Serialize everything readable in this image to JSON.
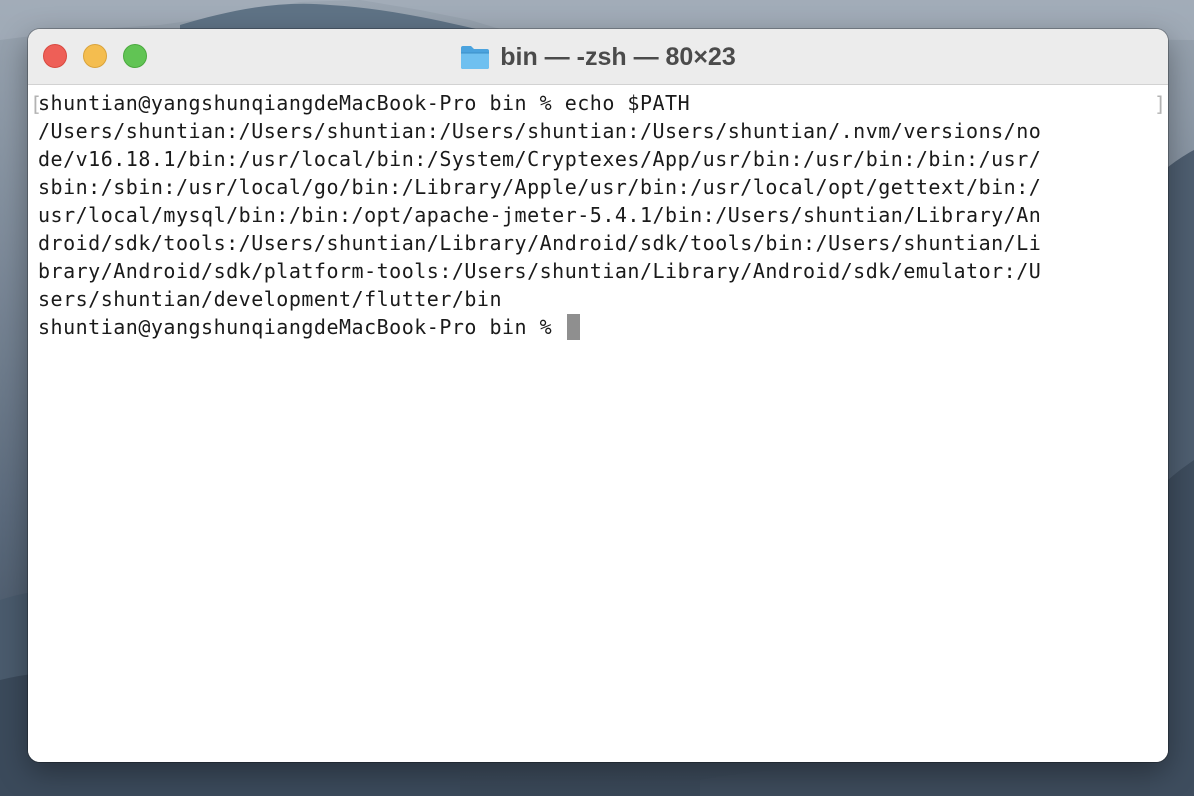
{
  "window": {
    "title": "bin — -zsh — 80×23",
    "folder_icon": "folder-icon",
    "controls": {
      "close": "close-icon",
      "minimize": "minimize-icon",
      "zoom": "zoom-icon"
    }
  },
  "terminal": {
    "lines": [
      "shuntian@yangshunqiangdeMacBook-Pro bin % echo $PATH",
      "/Users/shuntian:/Users/shuntian:/Users/shuntian:/Users/shuntian/.nvm/versions/no",
      "de/v16.18.1/bin:/usr/local/bin:/System/Cryptexes/App/usr/bin:/usr/bin:/bin:/usr/",
      "sbin:/sbin:/usr/local/go/bin:/Library/Apple/usr/bin:/usr/local/opt/gettext/bin:/",
      "usr/local/mysql/bin:/bin:/opt/apache-jmeter-5.4.1/bin:/Users/shuntian/Library/An",
      "droid/sdk/tools:/Users/shuntian/Library/Android/sdk/tools/bin:/Users/shuntian/Li",
      "brary/Android/sdk/platform-tools:/Users/shuntian/Library/Android/sdk/emulator:/U",
      "sers/shuntian/development/flutter/bin"
    ],
    "prompt": "shuntian@yangshunqiangdeMacBook-Pro bin % ",
    "bracket_left": "[",
    "bracket_right": "]"
  },
  "colors": {
    "close": "#ee5f57",
    "minimize": "#f4bd4f",
    "zoom": "#61c454",
    "titlebar": "#ececec",
    "text": "#1a1a1a",
    "cursor": "#8f8f8f"
  }
}
